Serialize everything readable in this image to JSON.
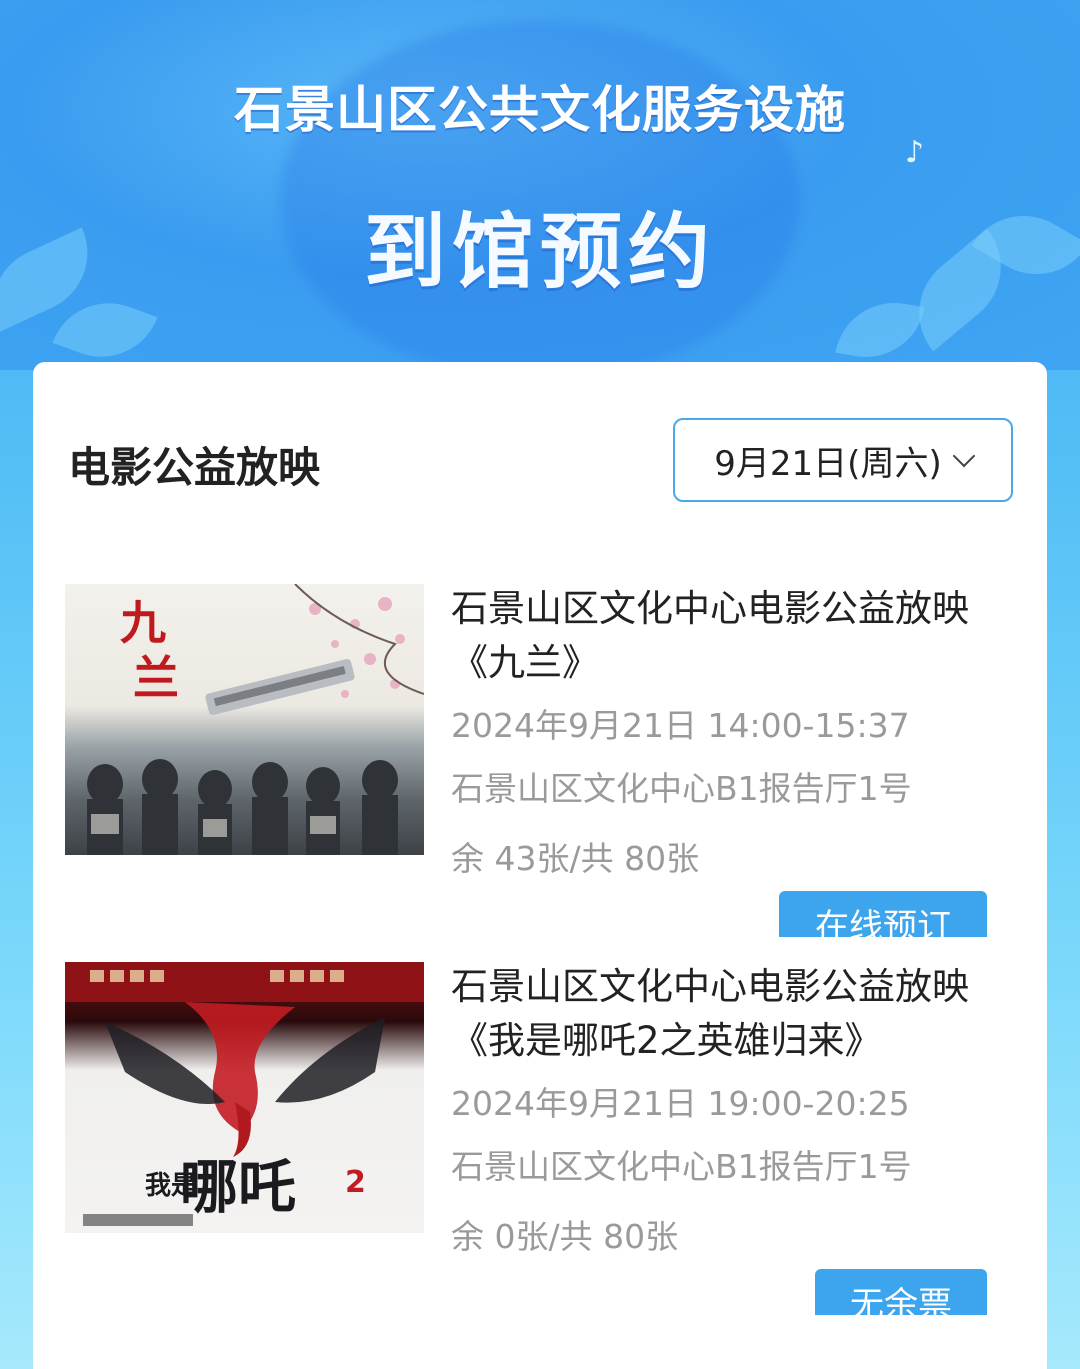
{
  "hero": {
    "title": "石景山区公共文化服务设施",
    "subtitle": "到馆预约",
    "note_icon": "music-note-icon"
  },
  "section": {
    "title": "电影公益放映",
    "date_select": {
      "value": "9月21日(周六)",
      "icon": "chevron-down-icon"
    }
  },
  "events": [
    {
      "title": "石景山区文化中心电影公益放映《九兰》",
      "time": "2024年9月21日 14:00-15:37",
      "place": "石景山区文化中心B1报告厅1号",
      "seats": "余 43张/共 80张",
      "button": "在线预订",
      "poster_text": "九兰"
    },
    {
      "title": "石景山区文化中心电影公益放映《我是哪吒2之英雄归来》",
      "time": "2024年9月21日 19:00-20:25",
      "place": "石景山区文化中心B1报告厅1号",
      "seats": "余 0张/共 80张",
      "button": "无余票",
      "poster_text": "哪吒2"
    }
  ],
  "colors": {
    "accent": "#3da4ee",
    "header_bg": "#3a9cf0",
    "muted_text": "#9a9a9a"
  }
}
